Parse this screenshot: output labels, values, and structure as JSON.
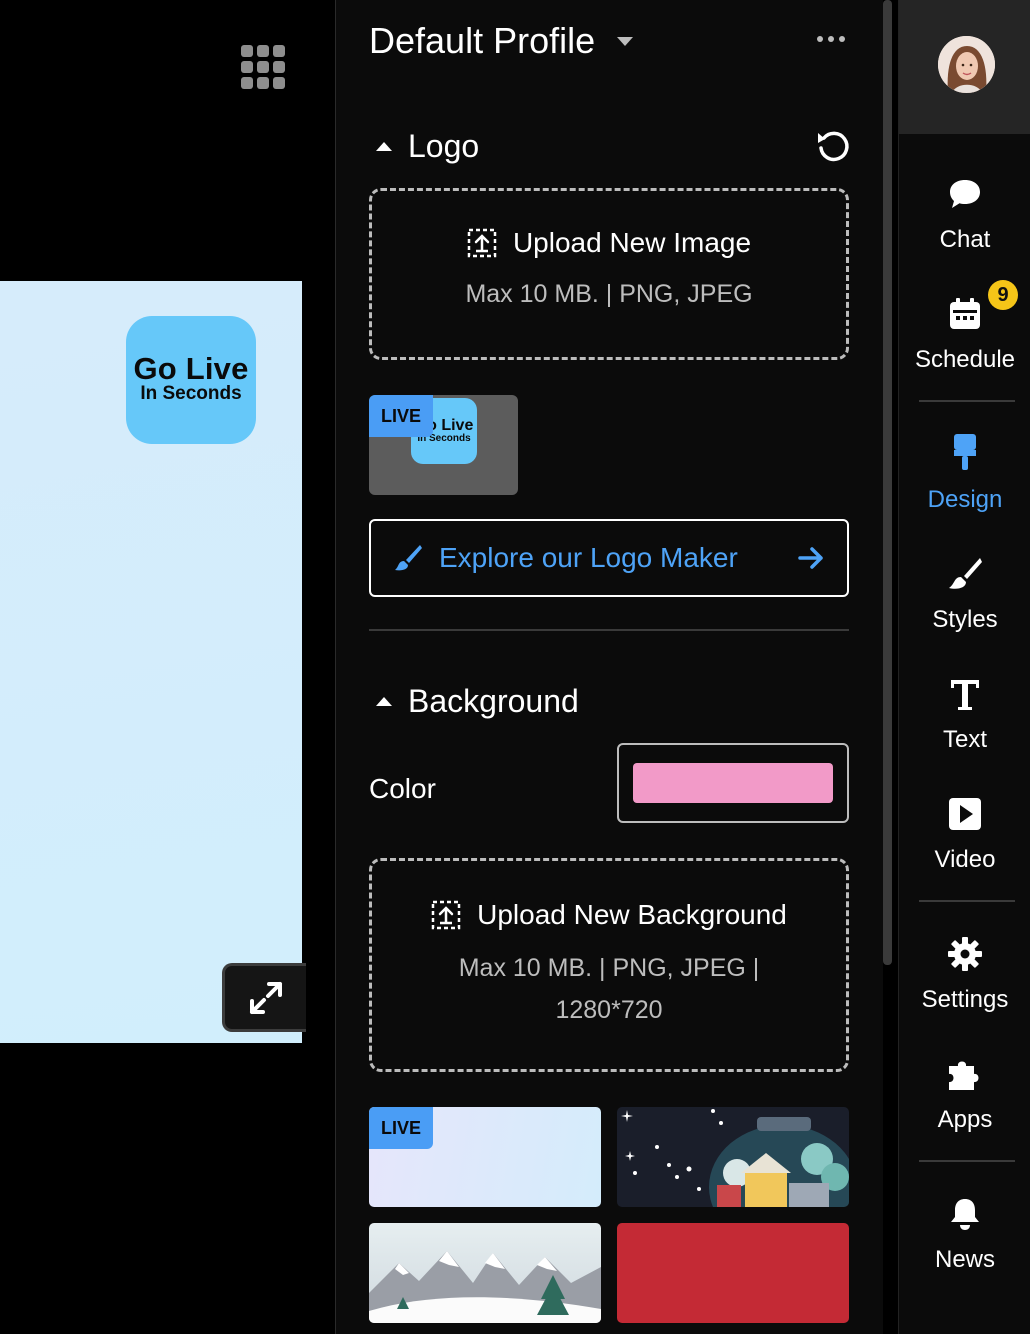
{
  "profile": {
    "title": "Default Profile"
  },
  "logo_section": {
    "title": "Logo",
    "upload_label": "Upload New Image",
    "upload_hint": "Max 10 MB. | PNG, JPEG",
    "thumb_live_badge": "LIVE",
    "thumb_text_line1": "Go Live",
    "thumb_text_line2": "In Seconds",
    "logo_maker_label": "Explore our Logo Maker"
  },
  "stage": {
    "logo_line1": "Go Live",
    "logo_line2": "In Seconds"
  },
  "background_section": {
    "title": "Background",
    "color_label": "Color",
    "color_value": "#f29ac8",
    "upload_label": "Upload New Background",
    "upload_hint_line1": "Max 10 MB. | PNG, JPEG |",
    "upload_hint_line2": "1280*720",
    "thumb_live_badge": "LIVE"
  },
  "rail": {
    "items": [
      {
        "label": "Chat",
        "icon": "chat-bubble-icon"
      },
      {
        "label": "Schedule",
        "icon": "calendar-icon",
        "badge": "9"
      },
      {
        "label": "Design",
        "icon": "paint-roller-icon",
        "active": true
      },
      {
        "label": "Styles",
        "icon": "brush-icon"
      },
      {
        "label": "Text",
        "icon": "text-icon"
      },
      {
        "label": "Video",
        "icon": "play-icon"
      },
      {
        "label": "Settings",
        "icon": "gear-icon"
      },
      {
        "label": "Apps",
        "icon": "puzzle-icon"
      },
      {
        "label": "News",
        "icon": "bell-icon"
      }
    ]
  },
  "colors": {
    "accent": "#4ea3f7",
    "badge": "#f5c518",
    "logo_blue": "#66c8f9"
  }
}
